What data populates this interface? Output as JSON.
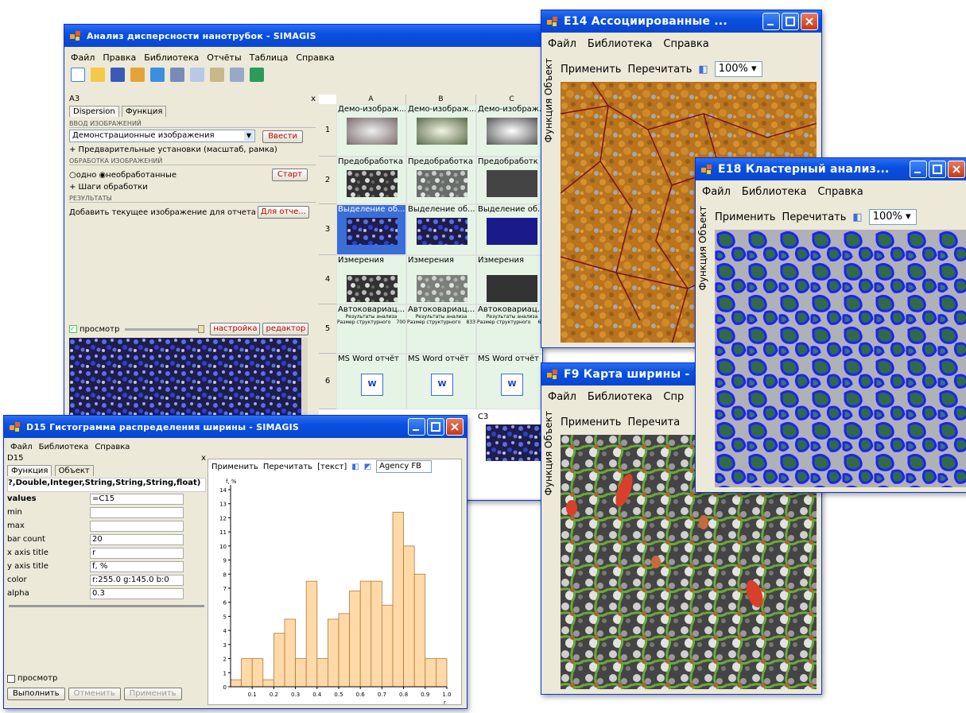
{
  "main_window": {
    "title": "Анализ дисперсности нанотрубок - SIMAGIS",
    "menu": [
      "Файл",
      "Правка",
      "Библиотека",
      "Отчёты",
      "Таблица",
      "Справка"
    ],
    "panel": {
      "cell_ref": "A3",
      "close": "x",
      "tabs": [
        "Dispersion",
        "Функция"
      ],
      "section_input": "ВВОД ИЗОБРАЖЕНИЙ",
      "source_value": "Демонстрационные изображения",
      "enter_button": "Ввести",
      "preset_label": "+ Предварительные установки (масштаб, рамка)",
      "section_processing": "ОБРАБОТКА ИЗОБРАЖЕНИЙ",
      "radio_one": "одно",
      "radio_unprocessed": "необработанные",
      "start_button": "Старт",
      "steps_label": "+ Шаги обработки",
      "section_results": "РЕЗУЛЬТАТЫ",
      "add_report_label": "Добавить текущее изображение для отчета",
      "report_button": "Для отче...",
      "preview_label": "просмотр",
      "settings_button": "настройка",
      "editor_button": "редактор"
    },
    "grid": {
      "columns": [
        "A",
        "B",
        "C"
      ],
      "rows": [
        "1",
        "2",
        "3",
        "4",
        "5",
        "6"
      ],
      "cells": [
        [
          "Демо-изображ...",
          "Демо-изображ...",
          "Демо-изображ..."
        ],
        [
          "Предобработка",
          "Предобработка",
          "Предобработк"
        ],
        [
          "Выделение об...",
          "Выделение об...",
          "Выделение об..."
        ],
        [
          "Измерения",
          "Измерения",
          "Измерения"
        ],
        [
          "Автоковариац...",
          "Автоковариац...",
          "Автоковариац..."
        ],
        [
          "MS Word отчёт",
          "MS Word отчёт",
          "MS Word отчёт"
        ]
      ],
      "report_header": "Результаты анализа",
      "report_label": "Размер структурного",
      "report_values": [
        "700",
        "833",
        "633"
      ],
      "extra_cell": "C3"
    }
  },
  "hist_window": {
    "title": "D15 Гистограмма распределения ширины - SIMAGIS",
    "menu": [
      "Файл",
      "Библиотека",
      "Справка"
    ],
    "panel": {
      "cell_ref": "D15",
      "close": "x",
      "tabs": [
        "Функция",
        "Объект"
      ],
      "signature": "?,Double,Integer,String,String,String,float)",
      "params": [
        {
          "name": "values",
          "value": "=C15"
        },
        {
          "name": "min",
          "value": ""
        },
        {
          "name": "max",
          "value": ""
        },
        {
          "name": "bar count",
          "value": "20"
        },
        {
          "name": "x axis title",
          "value": "r"
        },
        {
          "name": "y axis title",
          "value": "f, %"
        },
        {
          "name": "color",
          "value": "r:255.0 g:145.0 b:0"
        },
        {
          "name": "alpha",
          "value": "0.3"
        }
      ],
      "preview_label": "просмотр",
      "run_button": "Выполнить",
      "cancel_button": "Отменить",
      "apply_button": "Применить"
    },
    "toolbar": {
      "apply": "Применить",
      "reread": "Перечитать",
      "text": "[текст]",
      "font": "Agency FB"
    }
  },
  "chart_data": {
    "type": "bar",
    "xlabel": "r",
    "ylabel": "f, %",
    "xlim": [
      0.0,
      1.0
    ],
    "ylim": [
      0,
      14
    ],
    "xticks": [
      "0.1",
      "0.2",
      "0.3",
      "0.4",
      "0.5",
      "0.6",
      "0.7",
      "0.8",
      "0.9",
      "1.0"
    ],
    "yticks": [
      "0",
      "1",
      "2",
      "3",
      "4",
      "5",
      "6",
      "7",
      "8",
      "9",
      "10",
      "11",
      "12",
      "13",
      "14"
    ],
    "bin_width": 0.05,
    "x": [
      0.0,
      0.05,
      0.1,
      0.15,
      0.2,
      0.25,
      0.3,
      0.35,
      0.4,
      0.45,
      0.5,
      0.55,
      0.6,
      0.65,
      0.7,
      0.75,
      0.8,
      0.85,
      0.9,
      0.95
    ],
    "values": [
      0.5,
      2.0,
      2.0,
      0.5,
      3.8,
      4.8,
      2.0,
      7.5,
      2.0,
      4.8,
      5.2,
      6.8,
      7.5,
      7.5,
      5.8,
      12.4,
      10.0,
      8.0,
      2.0,
      2.0
    ],
    "color": "#ffd9a8"
  },
  "e14_window": {
    "title": "E14 Ассоциированные ...",
    "menu": [
      "Файл",
      "Библиотека",
      "Справка"
    ],
    "side_tabs": "Функция Объект",
    "apply": "Применить",
    "reread": "Перечитать",
    "zoom": "100%"
  },
  "e18_window": {
    "title": "E18 Кластерный анализ...",
    "menu": [
      "Файл",
      "Библиотека",
      "Справка"
    ],
    "side_tabs": "Функция Объект",
    "apply": "Применить",
    "reread": "Перечитать",
    "zoom": "100%"
  },
  "f9_window": {
    "title": "F9 Карта ширины -",
    "menu": [
      "Файл",
      "Библиотека",
      "Спр"
    ],
    "side_tabs": "Функция Объект",
    "apply": "Применить",
    "reread": "Перечита"
  },
  "colors": {
    "title_blue": "#0a50e0",
    "window_face": "#ece9d8",
    "orange_texture": "#c07a22",
    "blue_contour": "#1a22ff",
    "cluster_green": "#2f6a4a",
    "grain_red": "#d8402a"
  }
}
